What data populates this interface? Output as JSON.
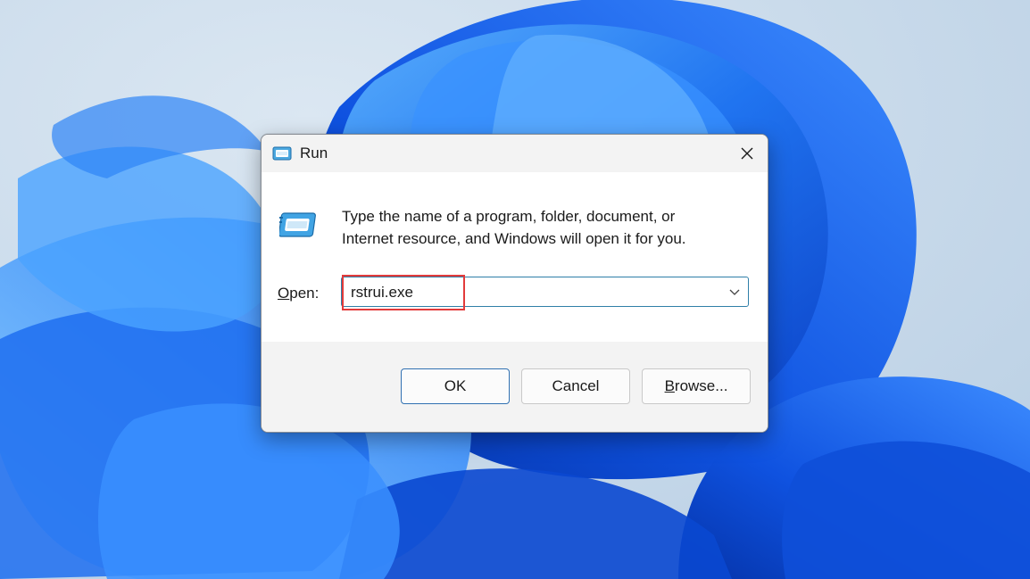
{
  "dialog": {
    "title": "Run",
    "close_icon": "close-icon",
    "app_icon": "run-window-icon",
    "description_line1": "Type the name of a program, folder, document, or",
    "description_line2": "Internet resource, and Windows will open it for you.",
    "open_label": "Open:",
    "open_value": "rstrui.exe",
    "buttons": {
      "ok": "OK",
      "cancel": "Cancel",
      "browse": "Browse..."
    }
  },
  "colors": {
    "accent_border": "#2f7fa8",
    "highlight": "#e23b3b",
    "wallpaper_blue": "#1e64e6"
  }
}
